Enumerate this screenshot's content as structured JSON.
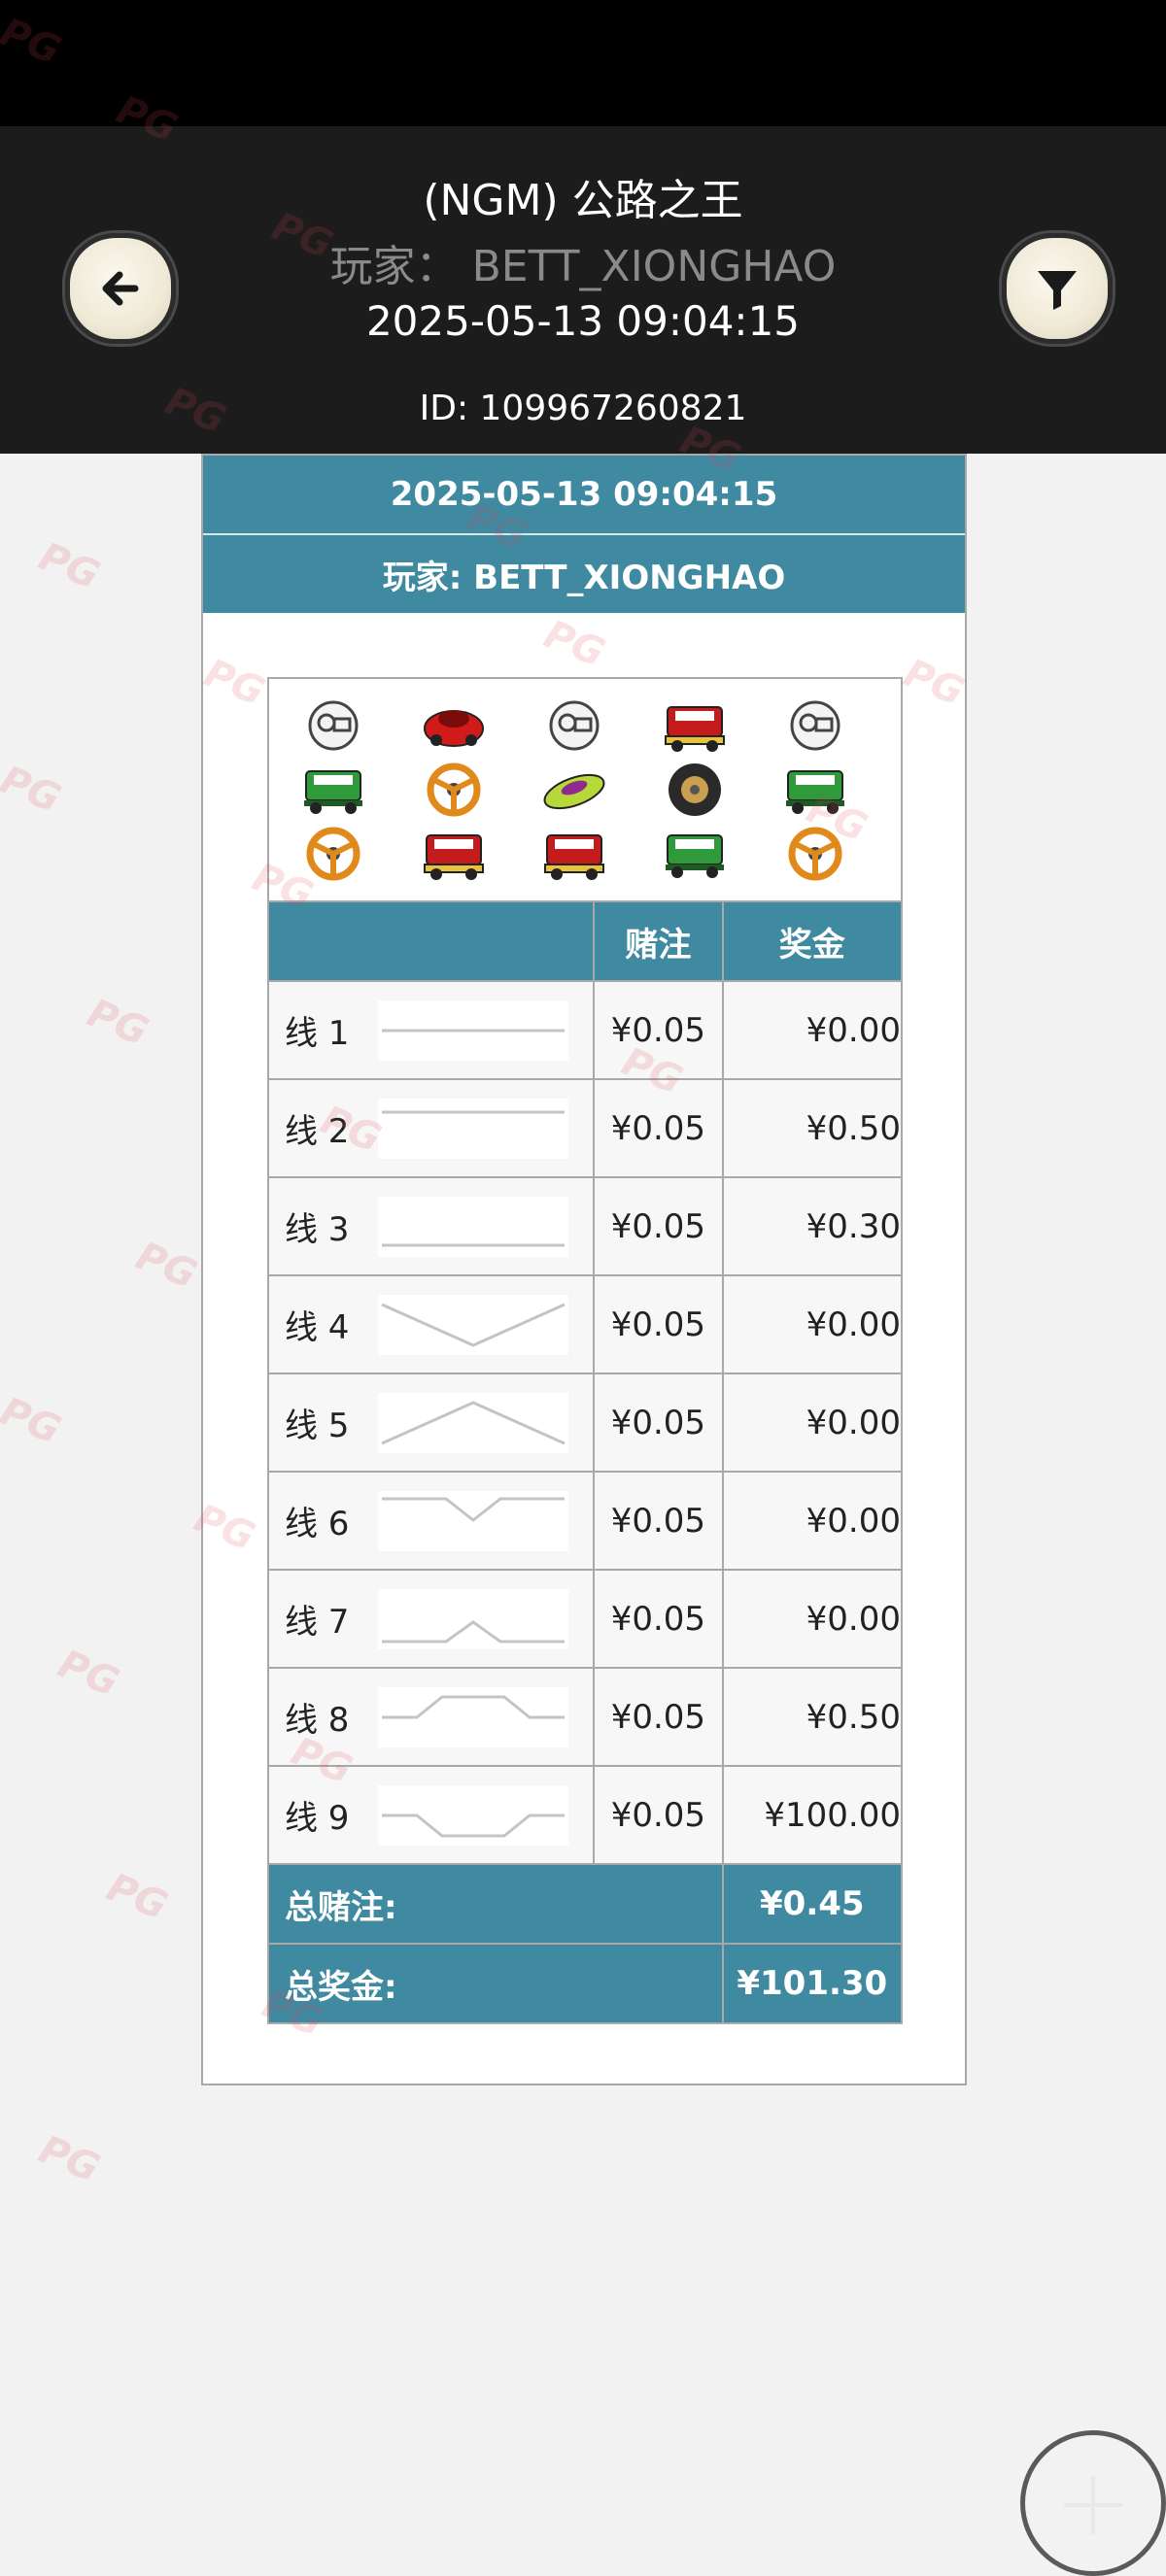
{
  "header": {
    "title": "(NGM) 公路之王",
    "player_line": "玩家：  BETT_XIONGHAO",
    "datetime": "2025-05-13  09:04:15",
    "id_line": "ID:  109967260821"
  },
  "card": {
    "datetime": "2025-05-13 09:04:15",
    "player": "玩家: BETT_XIONGHAO"
  },
  "reels": {
    "icons": [
      [
        "engine-icon",
        "red-car-icon",
        "engine-icon",
        "red-truck-icon",
        "engine-icon"
      ],
      [
        "green-truck-icon",
        "steering-wheel-icon",
        "green-car-icon",
        "tire-icon",
        "green-truck-icon"
      ],
      [
        "steering-wheel-icon",
        "red-truck-icon",
        "red-truck-icon",
        "green-truck-icon",
        "steering-wheel-icon"
      ]
    ]
  },
  "table": {
    "headers": [
      "",
      "赌注",
      "奖金"
    ],
    "rows": [
      {
        "line": "线 1",
        "bet": "¥0.05",
        "win": "¥0.00"
      },
      {
        "line": "线 2",
        "bet": "¥0.05",
        "win": "¥0.50"
      },
      {
        "line": "线 3",
        "bet": "¥0.05",
        "win": "¥0.30"
      },
      {
        "line": "线 4",
        "bet": "¥0.05",
        "win": "¥0.00"
      },
      {
        "line": "线 5",
        "bet": "¥0.05",
        "win": "¥0.00"
      },
      {
        "line": "线 6",
        "bet": "¥0.05",
        "win": "¥0.00"
      },
      {
        "line": "线 7",
        "bet": "¥0.05",
        "win": "¥0.00"
      },
      {
        "line": "线 8",
        "bet": "¥0.05",
        "win": "¥0.50"
      },
      {
        "line": "线 9",
        "bet": "¥0.05",
        "win": "¥100.00"
      }
    ],
    "total_bet_label": "总赌注:",
    "total_bet_value": "¥0.45",
    "total_win_label": "总奖金:",
    "total_win_value": "¥101.30"
  },
  "watermark": "PG",
  "colors": {
    "header_bg": "#1c1c1c",
    "accent": "#3f8aa0",
    "page_bg": "#f2f2f2"
  }
}
